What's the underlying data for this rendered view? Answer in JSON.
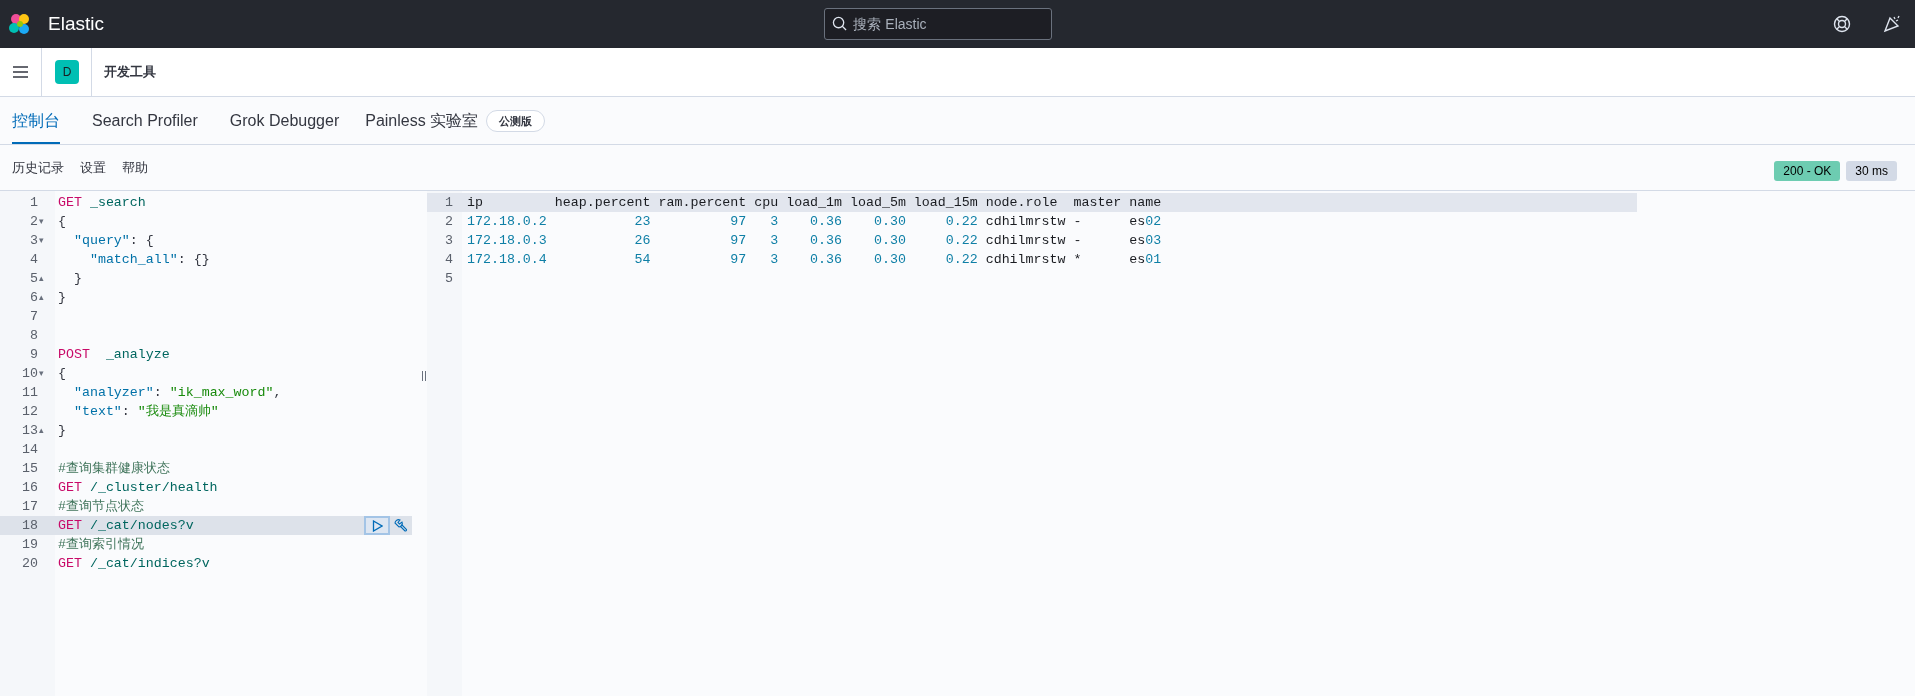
{
  "header": {
    "title": "Elastic",
    "search": {
      "placeholder": "搜索 Elastic"
    }
  },
  "breadcrumb": {
    "space_initial": "D",
    "title": "开发工具"
  },
  "tabs": [
    {
      "label": "控制台",
      "selected": true
    },
    {
      "label": "Search Profiler",
      "selected": false
    },
    {
      "label": "Grok Debugger",
      "selected": false
    },
    {
      "label": "Painless 实验室",
      "selected": false,
      "badge": "公测版"
    }
  ],
  "toolbar": {
    "links": [
      "历史记录",
      "设置",
      "帮助"
    ],
    "status": "200 - OK",
    "duration": "30 ms"
  },
  "editor": {
    "lines": [
      {
        "number": "1",
        "selected": false,
        "tokens": [
          {
            "kind": "method",
            "text": "GET"
          },
          {
            "kind": "path",
            "text": " _search"
          }
        ]
      },
      {
        "number": "2",
        "selected": false,
        "fold": "▾",
        "tokens": [
          {
            "kind": "punct",
            "text": "{"
          }
        ]
      },
      {
        "number": "3",
        "selected": false,
        "fold": "▾",
        "tokens": [
          {
            "kind": "key",
            "text": "  \"query\""
          },
          {
            "kind": "punct",
            "text": ": {"
          }
        ]
      },
      {
        "number": "4",
        "selected": false,
        "tokens": [
          {
            "kind": "key",
            "text": "    \"match_all\""
          },
          {
            "kind": "punct",
            "text": ": {}"
          }
        ]
      },
      {
        "number": "5",
        "selected": false,
        "fold": "▴",
        "tokens": [
          {
            "kind": "punct",
            "text": "  }"
          }
        ]
      },
      {
        "number": "6",
        "selected": false,
        "fold": "▴",
        "tokens": [
          {
            "kind": "punct",
            "text": "}"
          }
        ]
      },
      {
        "number": "7",
        "selected": false
      },
      {
        "number": "8",
        "selected": false
      },
      {
        "number": "9",
        "selected": false,
        "tokens": [
          {
            "kind": "method",
            "text": "POST"
          },
          {
            "kind": "path",
            "text": "  _analyze"
          }
        ]
      },
      {
        "number": "10",
        "selected": false,
        "fold": "▾",
        "tokens": [
          {
            "kind": "punct",
            "text": "{"
          }
        ]
      },
      {
        "number": "11",
        "selected": false,
        "tokens": [
          {
            "kind": "key",
            "text": "  \"analyzer\""
          },
          {
            "kind": "punct",
            "text": ": "
          },
          {
            "kind": "string",
            "text": "\"ik_max_word\""
          },
          {
            "kind": "punct",
            "text": ","
          }
        ]
      },
      {
        "number": "12",
        "selected": false,
        "tokens": [
          {
            "kind": "key",
            "text": "  \"text\""
          },
          {
            "kind": "punct",
            "text": ": "
          },
          {
            "kind": "string",
            "text": "\"我是真滴帅\""
          }
        ]
      },
      {
        "number": "13",
        "selected": false,
        "fold": "▴",
        "tokens": [
          {
            "kind": "punct",
            "text": "}"
          }
        ]
      },
      {
        "number": "14",
        "selected": false
      },
      {
        "number": "15",
        "selected": false,
        "tokens": [
          {
            "kind": "comment",
            "text": "#查询集群健康状态"
          }
        ]
      },
      {
        "number": "16",
        "selected": false,
        "tokens": [
          {
            "kind": "method",
            "text": "GET"
          },
          {
            "kind": "path",
            "text": " /_cluster/health"
          }
        ]
      },
      {
        "number": "17",
        "selected": false,
        "tokens": [
          {
            "kind": "comment",
            "text": "#查询节点状态"
          }
        ]
      },
      {
        "number": "18",
        "selected": true,
        "tokens": [
          {
            "kind": "method",
            "text": "GET"
          },
          {
            "kind": "path",
            "text": " /_cat/nodes?v"
          }
        ]
      },
      {
        "number": "19",
        "selected": false,
        "tokens": [
          {
            "kind": "comment",
            "text": "#查询索引情况"
          }
        ]
      },
      {
        "number": "20",
        "selected": false,
        "tokens": [
          {
            "kind": "method",
            "text": "GET"
          },
          {
            "kind": "path",
            "text": " /_cat/indices?v"
          }
        ]
      }
    ]
  },
  "output": {
    "lines": [
      {
        "number": "1",
        "selected": true,
        "tokens": [
          {
            "kind": "plain",
            "text": "ip         heap.percent ram.percent cpu load_1m load_5m load_15m node.role  master name"
          }
        ]
      },
      {
        "number": "2",
        "selected": false,
        "tokens": [
          {
            "kind": "num",
            "text": "172.18.0.2           23          97   3    0.36    0.30     0.22"
          },
          {
            "kind": "plain",
            "text": " cdhilmrstw -      es"
          },
          {
            "kind": "num",
            "text": "02"
          }
        ]
      },
      {
        "number": "3",
        "selected": false,
        "tokens": [
          {
            "kind": "num",
            "text": "172.18.0.3           26          97   3    0.36    0.30     0.22"
          },
          {
            "kind": "plain",
            "text": " cdhilmrstw -      es"
          },
          {
            "kind": "num",
            "text": "03"
          }
        ]
      },
      {
        "number": "4",
        "selected": false,
        "tokens": [
          {
            "kind": "num",
            "text": "172.18.0.4           54          97   3    0.36    0.30     0.22"
          },
          {
            "kind": "plain",
            "text": " cdhilmrstw *      es"
          },
          {
            "kind": "num",
            "text": "01"
          }
        ]
      },
      {
        "number": "5",
        "selected": false
      }
    ]
  }
}
